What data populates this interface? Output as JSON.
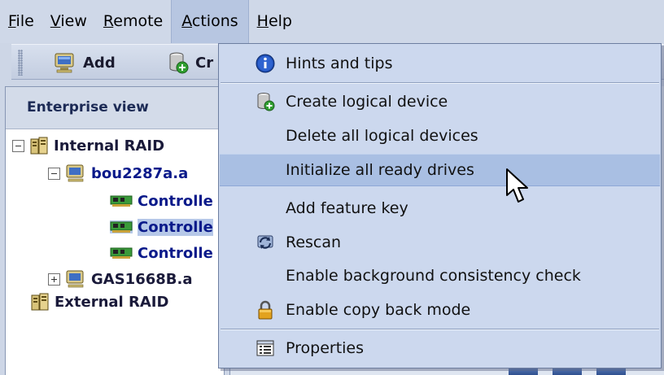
{
  "menubar": {
    "items": [
      {
        "label": "File",
        "mnemonic": "F",
        "rest": "ile"
      },
      {
        "label": "View",
        "mnemonic": "V",
        "rest": "iew"
      },
      {
        "label": "Remote",
        "mnemonic": "R",
        "rest": "emote"
      },
      {
        "label": "Actions",
        "mnemonic": "A",
        "rest": "ctions"
      },
      {
        "label": "Help",
        "mnemonic": "H",
        "rest": "elp"
      }
    ],
    "active": "Actions"
  },
  "toolbar": {
    "add_label": "Add",
    "create_label": "Cr"
  },
  "left_panel": {
    "title": "Enterprise view",
    "tree": {
      "internal_raid": "Internal RAID",
      "host1": "bou2287a.a",
      "controller1": "Controlle",
      "controller2": "Controlle",
      "controller3": "Controlle",
      "host2": "GAS1668B.a",
      "external_raid": "External RAID"
    }
  },
  "actions_menu": {
    "items": [
      {
        "label": "Hints and tips",
        "icon": "info-icon"
      },
      {
        "label": "Create logical device",
        "icon": "create-logical-device-icon"
      },
      {
        "label": "Delete all logical devices",
        "icon": ""
      },
      {
        "label": "Initialize all ready drives",
        "icon": "",
        "highlighted": true
      },
      {
        "label": "Add feature key",
        "icon": ""
      },
      {
        "label": "Rescan",
        "icon": "rescan-icon"
      },
      {
        "label": "Enable background consistency check",
        "icon": ""
      },
      {
        "label": "Enable copy back mode",
        "icon": "lock-icon"
      },
      {
        "label": "Properties",
        "icon": "properties-icon"
      }
    ]
  },
  "colors": {
    "menu_background": "#ccd8ee",
    "highlight": "#a9bfe3",
    "menubar_active": "#b7c6e1"
  }
}
